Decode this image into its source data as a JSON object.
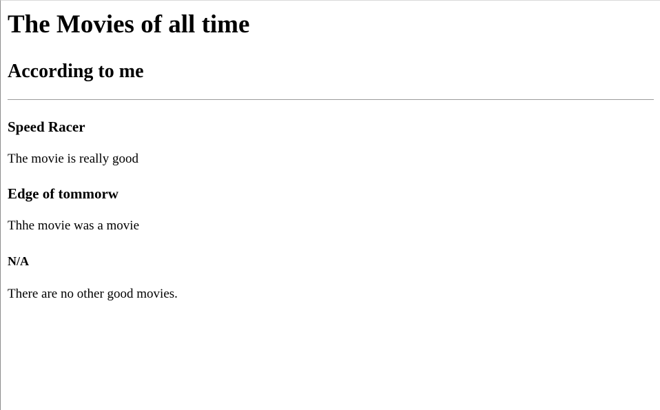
{
  "page": {
    "title": "The Movies of all time",
    "subtitle": "According to me"
  },
  "movies": [
    {
      "title": "Speed Racer",
      "description": "The movie is really good"
    },
    {
      "title": "Edge of tommorw",
      "description": "Thhe movie was a movie"
    },
    {
      "title": "N/A",
      "description": "There are no other good movies."
    }
  ]
}
